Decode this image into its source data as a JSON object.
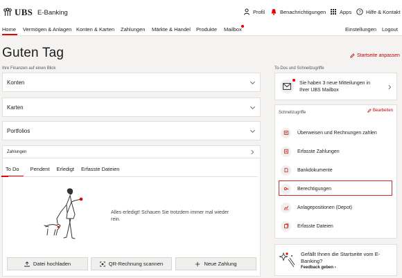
{
  "header": {
    "brand": "UBS",
    "app_name": "E-Banking",
    "profile": "Profil",
    "notifications": "Benachrichtigungen",
    "apps": "Apps",
    "help": "Hilfe & Kontakt"
  },
  "nav": {
    "items": [
      "Home",
      "Vermögen & Anlagen",
      "Konten & Karten",
      "Zahlungen",
      "Märkte & Handel",
      "Produkte",
      "Mailbox"
    ],
    "settings": "Einstellungen",
    "logout": "Logout"
  },
  "main": {
    "greeting": "Guten Tag",
    "customize": "Startseite anpassen",
    "finances_caption": "Ihre Finanzen auf einen Blick",
    "accordions": [
      "Konten",
      "Karten",
      "Portfolios"
    ],
    "payments": {
      "title": "Zahlungen",
      "tabs": [
        "To Do",
        "Pendent",
        "Erledigt",
        "Erfasste Dateien"
      ],
      "empty_message": "Alles erledigt! Schauen Sie trotzdem immer mal wieder rein.",
      "buttons": [
        "Datei hochladen",
        "QR-Rechnung scannen",
        "Neue Zahlung"
      ]
    }
  },
  "side": {
    "caption": "To-Dos und Schnellzugriffe",
    "mailbox_message": "Sie haben 3 neue Mitteilungen in Ihrer UBS Mailbox",
    "quick_title": "Schnellzugriffe",
    "edit": "Bearbeiten",
    "quick_items": [
      "Überweisen und Rechnungen zahlen",
      "Erfasste Zahlungen",
      "Bankdokumente",
      "Berechtigungen",
      "Anlagepositionen (Depot)",
      "Erfasste Dateien"
    ],
    "feedback_question": "Gefällt Ihnen die Startseite vom E-Banking?",
    "feedback_link": "Feedback geben"
  },
  "colors": {
    "accent": "#e60000",
    "background": "#f4f3f1",
    "highlight_border": "#d12a2a"
  }
}
